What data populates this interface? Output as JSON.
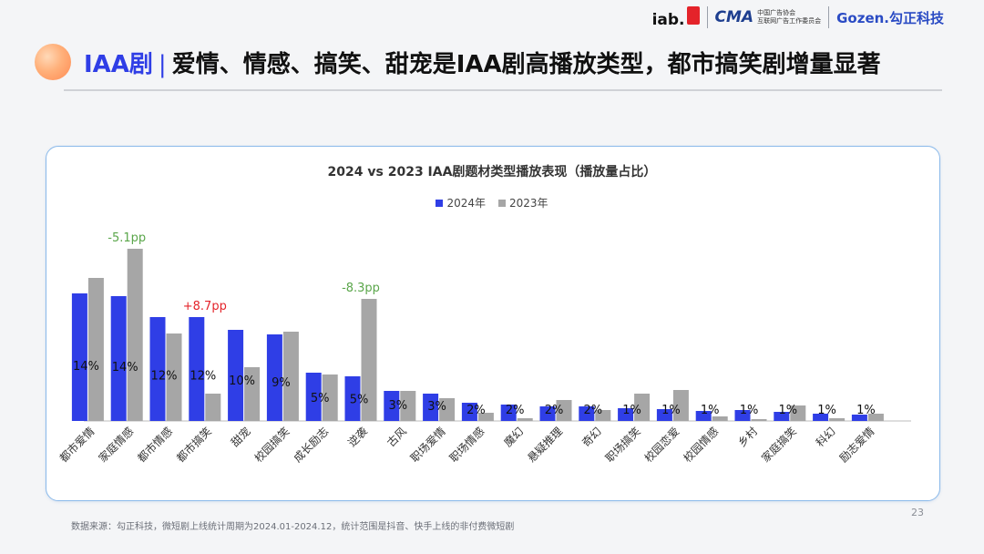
{
  "header": {
    "tag": "IAA剧",
    "divider": "|",
    "headline": "爱情、情感、搞笑、甜宠是IAA剧高播放类型，都市搞笑剧增量显著"
  },
  "logos": {
    "iab": "iab.",
    "cma_mark": "CMA",
    "cma_line1": "中国广告协会",
    "cma_line2": "互联网广告工作委员会",
    "gozen": "Gozen.勾正科技"
  },
  "footer": {
    "source": "数据来源：勾正科技，微短剧上线统计周期为2024.01-2024.12，统计范围是抖音、快手上线的非付费微短剧",
    "page_number": "23"
  },
  "colors": {
    "series_2024": "#2f3ee6",
    "series_2023": "#a6a6a6",
    "accent_title": "#2f3ee6",
    "up": "#e4232a",
    "down": "#5aa64a"
  },
  "chart_data": {
    "type": "bar",
    "title": "2024 vs 2023 IAA剧题材类型播放表现（播放量占比）",
    "legend_position": "top-center",
    "grid": false,
    "ylim": [
      0,
      20
    ],
    "categories": [
      "都市爱情",
      "家庭情感",
      "都市情感",
      "都市搞笑",
      "甜宠",
      "校园搞笑",
      "成长励志",
      "逆袭",
      "古风",
      "职场爱情",
      "职场情感",
      "魔幻",
      "悬疑推理",
      "奇幻",
      "职场搞笑",
      "校园恋爱",
      "校园情感",
      "乡村",
      "家庭搞笑",
      "科幻",
      "励志爱情"
    ],
    "series": [
      {
        "name": "2024年",
        "values": [
          14.0,
          13.7,
          11.4,
          11.4,
          10.0,
          9.5,
          5.3,
          4.9,
          3.3,
          3.0,
          2.0,
          1.8,
          1.6,
          1.6,
          1.4,
          1.3,
          1.1,
          1.2,
          1.0,
          0.8,
          0.7
        ]
      },
      {
        "name": "2023年",
        "values": [
          15.7,
          18.9,
          9.6,
          3.0,
          5.9,
          9.8,
          5.1,
          13.4,
          3.3,
          2.5,
          0.9,
          0.3,
          2.3,
          1.2,
          3.0,
          3.4,
          0.5,
          0.2,
          1.7,
          0.3,
          0.8
        ]
      }
    ],
    "data_labels": [
      "14%",
      "14%",
      "12%",
      "12%",
      "10%",
      "9%",
      "5%",
      "5%",
      "3%",
      "3%",
      "2%",
      "2%",
      "2%",
      "2%",
      "1%",
      "1%",
      "1%",
      "1%",
      "1%",
      "1%",
      "1%"
    ],
    "annotations": [
      {
        "category": "家庭情感",
        "text": "-5.1pp",
        "direction": "down"
      },
      {
        "category": "都市搞笑",
        "text": "+8.7pp",
        "direction": "up"
      },
      {
        "category": "逆袭",
        "text": "-8.3pp",
        "direction": "down"
      }
    ]
  }
}
